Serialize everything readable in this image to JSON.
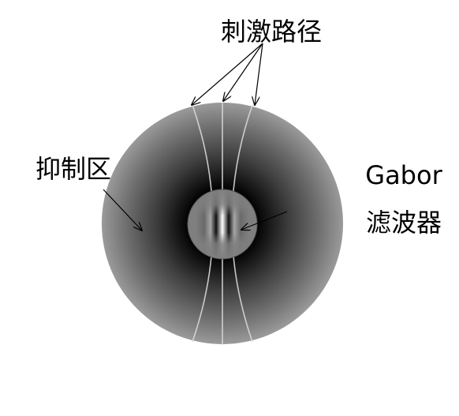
{
  "labels": {
    "stimulus_path": "刺激路径",
    "inhibition_zone": "抑制区",
    "gabor_line1": "Gabor",
    "gabor_line2": "滤波器"
  },
  "colors": {
    "background": "#ffffff",
    "outer_edge_gray": "#9a9a9a",
    "ring_dark": "#050505",
    "path_line": "#d8d8d8",
    "arrow": "#000000"
  }
}
